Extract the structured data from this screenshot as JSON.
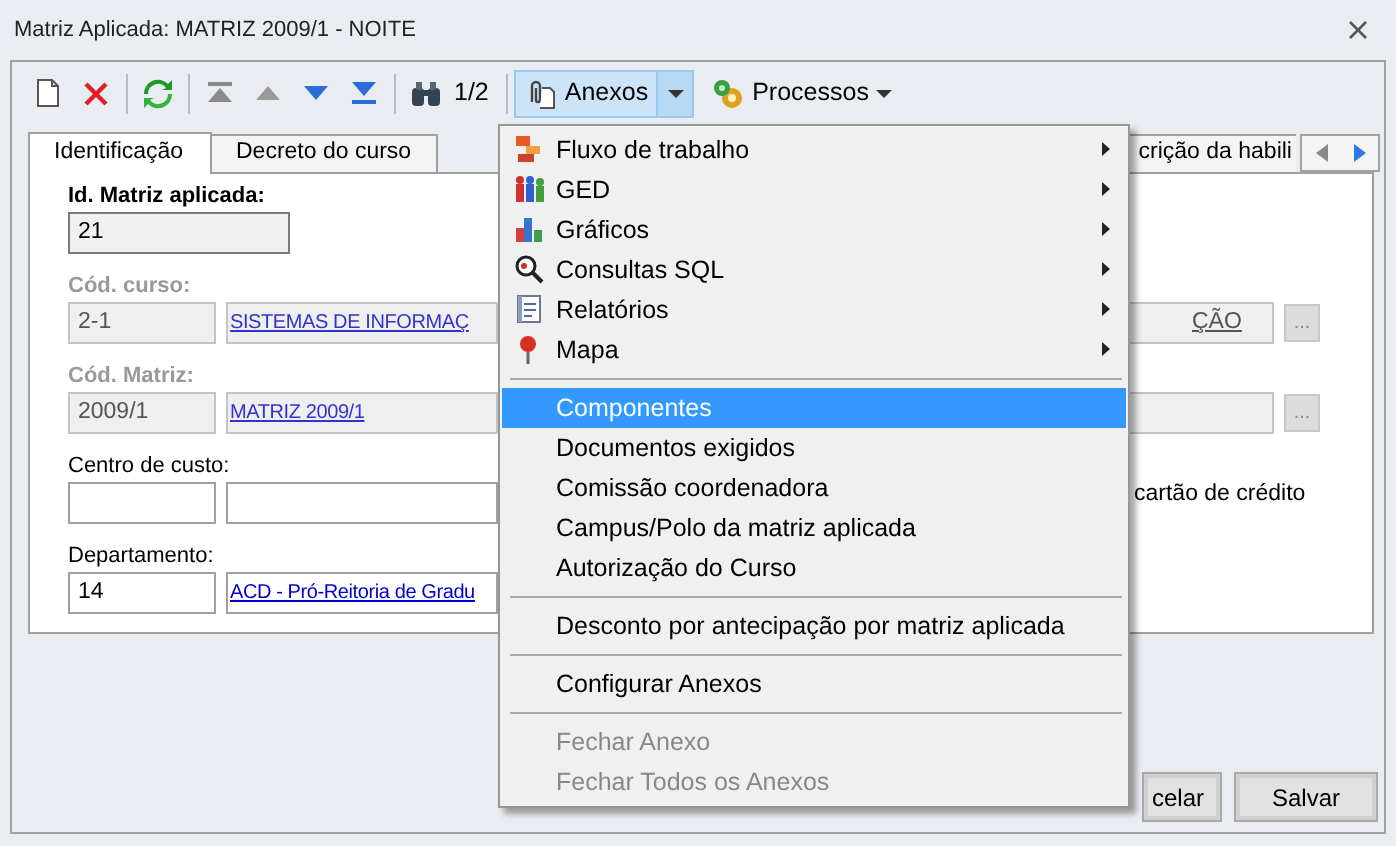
{
  "window": {
    "title": "Matriz Aplicada: MATRIZ 2009/1 - NOITE"
  },
  "toolbar": {
    "record_position": "1/2",
    "buttons": [
      {
        "label": "Anexos",
        "kind": "split",
        "active": true
      },
      {
        "label": "Processos",
        "kind": "dropdown",
        "active": false
      }
    ]
  },
  "tabs": [
    {
      "label": "Identificação",
      "selected": true
    },
    {
      "label": "Decreto do curso",
      "selected": false
    },
    {
      "label": "crição da habili",
      "selected": false
    }
  ],
  "fields": [
    {
      "kind": "single",
      "label": "Id. Matriz aplicada:",
      "required": true,
      "disabled": false,
      "value": "21"
    },
    {
      "kind": "lookup",
      "label": "Cód. curso:",
      "required": true,
      "disabled": true,
      "code": "2-1",
      "description": "SISTEMAS DE INFORMAÇ",
      "description_end": "ÇÃO",
      "lookup_button": "..."
    },
    {
      "kind": "lookup",
      "label": "Cód. Matriz:",
      "required": true,
      "disabled": true,
      "code": "2009/1",
      "description": "MATRIZ 2009/1",
      "lookup_button": "..."
    },
    {
      "kind": "lookup",
      "label": "Centro de custo:",
      "required": false,
      "disabled": false,
      "side_text": "cartão de crédito"
    },
    {
      "kind": "lookup",
      "label": "Departamento:",
      "required": false,
      "disabled": false,
      "code": "14",
      "description": "ACD - Pró-Reitoria de Gradu"
    }
  ],
  "footer_buttons": [
    "celar",
    "Salvar"
  ],
  "menu": {
    "items": [
      {
        "kind": "submenu",
        "label": "Fluxo de trabalho",
        "selected": false,
        "disabled": false
      },
      {
        "kind": "submenu",
        "label": "GED",
        "selected": false,
        "disabled": false
      },
      {
        "kind": "submenu",
        "label": "Gráficos",
        "selected": false,
        "disabled": false
      },
      {
        "kind": "submenu",
        "label": "Consultas SQL",
        "selected": false,
        "disabled": false
      },
      {
        "kind": "submenu",
        "label": "Relatórios",
        "selected": false,
        "disabled": false
      },
      {
        "kind": "submenu",
        "label": "Mapa",
        "selected": false,
        "disabled": false
      },
      {
        "kind": "separator"
      },
      {
        "kind": "item",
        "label": "Componentes",
        "selected": true,
        "disabled": false
      },
      {
        "kind": "item",
        "label": "Documentos exigidos",
        "selected": false,
        "disabled": false
      },
      {
        "kind": "item",
        "label": "Comissão coordenadora",
        "selected": false,
        "disabled": false
      },
      {
        "kind": "item",
        "label": "Campus/Polo da matriz aplicada",
        "selected": false,
        "disabled": false
      },
      {
        "kind": "item",
        "label": "Autorização do Curso",
        "selected": false,
        "disabled": false
      },
      {
        "kind": "separator"
      },
      {
        "kind": "item",
        "label": "Desconto por antecipação por matriz aplicada",
        "selected": false,
        "disabled": false
      },
      {
        "kind": "separator"
      },
      {
        "kind": "item",
        "label": "Configurar Anexos",
        "selected": false,
        "disabled": false
      },
      {
        "kind": "separator"
      },
      {
        "kind": "item",
        "label": "Fechar Anexo",
        "selected": false,
        "disabled": true
      },
      {
        "kind": "item",
        "label": "Fechar Todos os Anexos",
        "selected": false,
        "disabled": true
      }
    ]
  }
}
